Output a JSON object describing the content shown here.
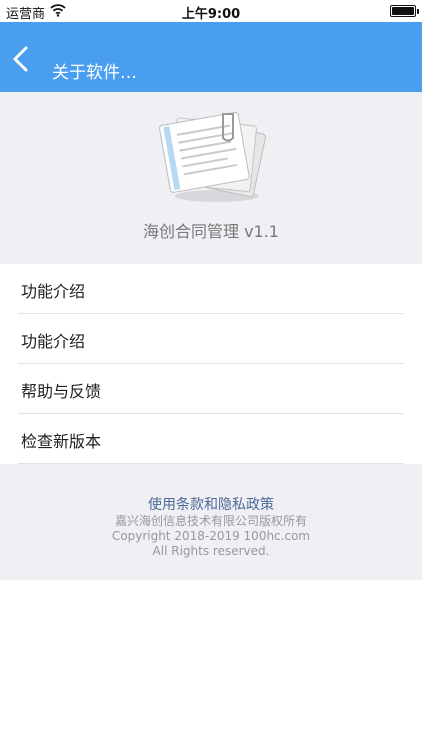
{
  "status_bar": {
    "carrier": "运营商",
    "time": "上午9:00",
    "wifi_icon": "wifi-icon",
    "battery_icon": "battery-icon"
  },
  "nav": {
    "back_icon": "chevron-left-icon",
    "title": "关于软件…",
    "color": "#4a9ef0"
  },
  "app": {
    "logo_icon": "document-stack-icon",
    "name": "海创合同管理 v1.1"
  },
  "menu": {
    "items": [
      {
        "label": "功能介绍"
      },
      {
        "label": "功能介绍"
      },
      {
        "label": "帮助与反馈"
      },
      {
        "label": "检查新版本"
      }
    ]
  },
  "footer": {
    "terms_link": "使用条款和隐私政策",
    "copyright_cn": "嘉兴海创信息技术有限公司版权所有",
    "copyright_en": "Copyright 2018-2019 100hc.com",
    "rights": "All Rights reserved."
  }
}
